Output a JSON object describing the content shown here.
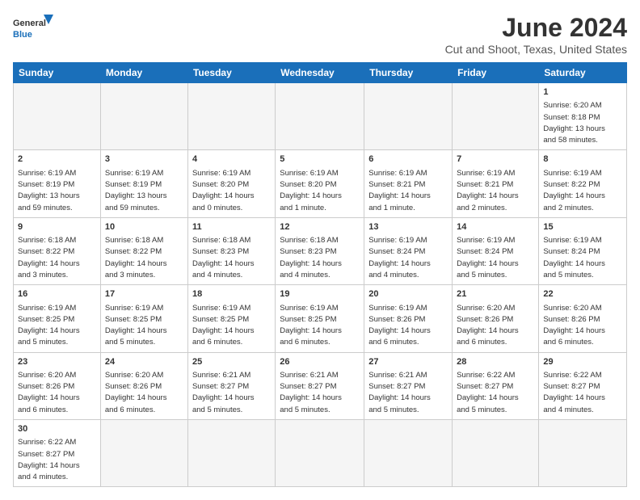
{
  "header": {
    "logo_general": "General",
    "logo_blue": "Blue",
    "month_title": "June 2024",
    "subtitle": "Cut and Shoot, Texas, United States"
  },
  "weekdays": [
    "Sunday",
    "Monday",
    "Tuesday",
    "Wednesday",
    "Thursday",
    "Friday",
    "Saturday"
  ],
  "weeks": [
    [
      {
        "day": "",
        "info": ""
      },
      {
        "day": "",
        "info": ""
      },
      {
        "day": "",
        "info": ""
      },
      {
        "day": "",
        "info": ""
      },
      {
        "day": "",
        "info": ""
      },
      {
        "day": "",
        "info": ""
      },
      {
        "day": "1",
        "info": "Sunrise: 6:20 AM\nSunset: 8:18 PM\nDaylight: 13 hours\nand 58 minutes."
      }
    ],
    [
      {
        "day": "2",
        "info": "Sunrise: 6:19 AM\nSunset: 8:19 PM\nDaylight: 13 hours\nand 59 minutes."
      },
      {
        "day": "3",
        "info": "Sunrise: 6:19 AM\nSunset: 8:19 PM\nDaylight: 13 hours\nand 59 minutes."
      },
      {
        "day": "4",
        "info": "Sunrise: 6:19 AM\nSunset: 8:20 PM\nDaylight: 14 hours\nand 0 minutes."
      },
      {
        "day": "5",
        "info": "Sunrise: 6:19 AM\nSunset: 8:20 PM\nDaylight: 14 hours\nand 1 minute."
      },
      {
        "day": "6",
        "info": "Sunrise: 6:19 AM\nSunset: 8:21 PM\nDaylight: 14 hours\nand 1 minute."
      },
      {
        "day": "7",
        "info": "Sunrise: 6:19 AM\nSunset: 8:21 PM\nDaylight: 14 hours\nand 2 minutes."
      },
      {
        "day": "8",
        "info": "Sunrise: 6:19 AM\nSunset: 8:22 PM\nDaylight: 14 hours\nand 2 minutes."
      }
    ],
    [
      {
        "day": "9",
        "info": "Sunrise: 6:18 AM\nSunset: 8:22 PM\nDaylight: 14 hours\nand 3 minutes."
      },
      {
        "day": "10",
        "info": "Sunrise: 6:18 AM\nSunset: 8:22 PM\nDaylight: 14 hours\nand 3 minutes."
      },
      {
        "day": "11",
        "info": "Sunrise: 6:18 AM\nSunset: 8:23 PM\nDaylight: 14 hours\nand 4 minutes."
      },
      {
        "day": "12",
        "info": "Sunrise: 6:18 AM\nSunset: 8:23 PM\nDaylight: 14 hours\nand 4 minutes."
      },
      {
        "day": "13",
        "info": "Sunrise: 6:19 AM\nSunset: 8:24 PM\nDaylight: 14 hours\nand 4 minutes."
      },
      {
        "day": "14",
        "info": "Sunrise: 6:19 AM\nSunset: 8:24 PM\nDaylight: 14 hours\nand 5 minutes."
      },
      {
        "day": "15",
        "info": "Sunrise: 6:19 AM\nSunset: 8:24 PM\nDaylight: 14 hours\nand 5 minutes."
      }
    ],
    [
      {
        "day": "16",
        "info": "Sunrise: 6:19 AM\nSunset: 8:25 PM\nDaylight: 14 hours\nand 5 minutes."
      },
      {
        "day": "17",
        "info": "Sunrise: 6:19 AM\nSunset: 8:25 PM\nDaylight: 14 hours\nand 5 minutes."
      },
      {
        "day": "18",
        "info": "Sunrise: 6:19 AM\nSunset: 8:25 PM\nDaylight: 14 hours\nand 6 minutes."
      },
      {
        "day": "19",
        "info": "Sunrise: 6:19 AM\nSunset: 8:25 PM\nDaylight: 14 hours\nand 6 minutes."
      },
      {
        "day": "20",
        "info": "Sunrise: 6:19 AM\nSunset: 8:26 PM\nDaylight: 14 hours\nand 6 minutes."
      },
      {
        "day": "21",
        "info": "Sunrise: 6:20 AM\nSunset: 8:26 PM\nDaylight: 14 hours\nand 6 minutes."
      },
      {
        "day": "22",
        "info": "Sunrise: 6:20 AM\nSunset: 8:26 PM\nDaylight: 14 hours\nand 6 minutes."
      }
    ],
    [
      {
        "day": "23",
        "info": "Sunrise: 6:20 AM\nSunset: 8:26 PM\nDaylight: 14 hours\nand 6 minutes."
      },
      {
        "day": "24",
        "info": "Sunrise: 6:20 AM\nSunset: 8:26 PM\nDaylight: 14 hours\nand 6 minutes."
      },
      {
        "day": "25",
        "info": "Sunrise: 6:21 AM\nSunset: 8:27 PM\nDaylight: 14 hours\nand 5 minutes."
      },
      {
        "day": "26",
        "info": "Sunrise: 6:21 AM\nSunset: 8:27 PM\nDaylight: 14 hours\nand 5 minutes."
      },
      {
        "day": "27",
        "info": "Sunrise: 6:21 AM\nSunset: 8:27 PM\nDaylight: 14 hours\nand 5 minutes."
      },
      {
        "day": "28",
        "info": "Sunrise: 6:22 AM\nSunset: 8:27 PM\nDaylight: 14 hours\nand 5 minutes."
      },
      {
        "day": "29",
        "info": "Sunrise: 6:22 AM\nSunset: 8:27 PM\nDaylight: 14 hours\nand 4 minutes."
      }
    ],
    [
      {
        "day": "30",
        "info": "Sunrise: 6:22 AM\nSunset: 8:27 PM\nDaylight: 14 hours\nand 4 minutes."
      },
      {
        "day": "",
        "info": ""
      },
      {
        "day": "",
        "info": ""
      },
      {
        "day": "",
        "info": ""
      },
      {
        "day": "",
        "info": ""
      },
      {
        "day": "",
        "info": ""
      },
      {
        "day": "",
        "info": ""
      }
    ]
  ]
}
